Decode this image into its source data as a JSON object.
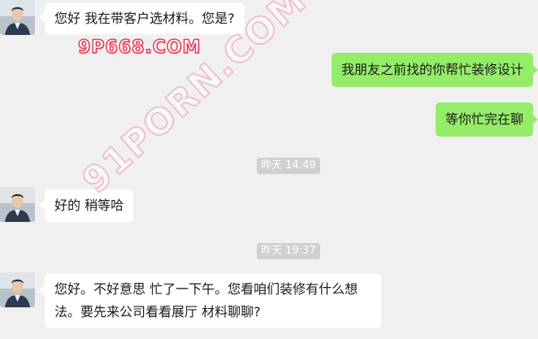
{
  "messages": [
    {
      "side": "left",
      "text": "您好 我在带客户选材料。您是?"
    },
    {
      "side": "right",
      "text": "我朋友之前找的你帮忙装修设计"
    },
    {
      "side": "right",
      "text": "等你忙完在聊"
    },
    {
      "side": "time",
      "text": "昨天 14:49"
    },
    {
      "side": "left",
      "text": "好的 稍等哈"
    },
    {
      "side": "time",
      "text": "昨天 19:37"
    },
    {
      "side": "left",
      "text": "您好。不好意思 忙了一下午。您看咱们装修有什么想法。要先来公司看看展厅 材料聊聊?"
    }
  ],
  "watermarks": {
    "top": "9P668.COM",
    "diagonal": "91PORN.COM"
  },
  "colors": {
    "background": "#f0f0f0",
    "left_bubble": "#ffffff",
    "right_bubble": "#95ec69",
    "timestamp_bg": "#d0d0d0",
    "watermark": "#e23b5a"
  }
}
